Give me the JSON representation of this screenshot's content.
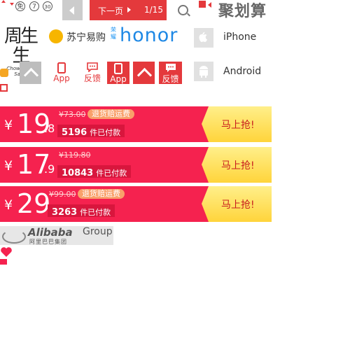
{
  "top_bar": {
    "icon_badges": [
      "免",
      "7",
      "30"
    ],
    "next_page_label": "下一页",
    "page_indicator": "1/15",
    "brand_title": "聚划算"
  },
  "brands": {
    "chow_sang_sang_cn": "周生生",
    "chow_sang_sang_en": "Chow Sang Sang",
    "suning": "苏宁易购",
    "honor_tag": "荣耀",
    "honor": "honor",
    "iphone_label": "iPhone",
    "android_label": "Android"
  },
  "app_row": {
    "app_label_1": "App",
    "feedback_label_1": "反馈",
    "app_label_2": "App",
    "feedback_label_2": "反馈"
  },
  "deals": [
    {
      "yen": "¥",
      "price_int": "19",
      "price_dec": ".8",
      "original_price": "¥73.00",
      "badge": "退货赔运费",
      "sold_count": "5196",
      "sold_unit": "件已付款",
      "cta": "马上抢!"
    },
    {
      "yen": "¥",
      "price_int": "17",
      "price_dec": ".9",
      "original_price": "¥119.80",
      "badge": "",
      "sold_count": "10843",
      "sold_unit": "件已付款",
      "cta": "马上抢!"
    },
    {
      "yen": "¥",
      "price_int": "29",
      "price_dec": "",
      "original_price": "¥99.00",
      "badge": "退货赔运费",
      "sold_count": "3263",
      "sold_unit": "件已付款",
      "cta": "马上抢!"
    }
  ],
  "footer": {
    "alibaba_name": "Alibaba",
    "alibaba_group": "Group",
    "alibaba_cn": "阿里巴巴集团"
  },
  "colors": {
    "deal_red": "#f5224f",
    "accent_red": "#e4393c",
    "grab_yellow": "#ffd43b"
  }
}
